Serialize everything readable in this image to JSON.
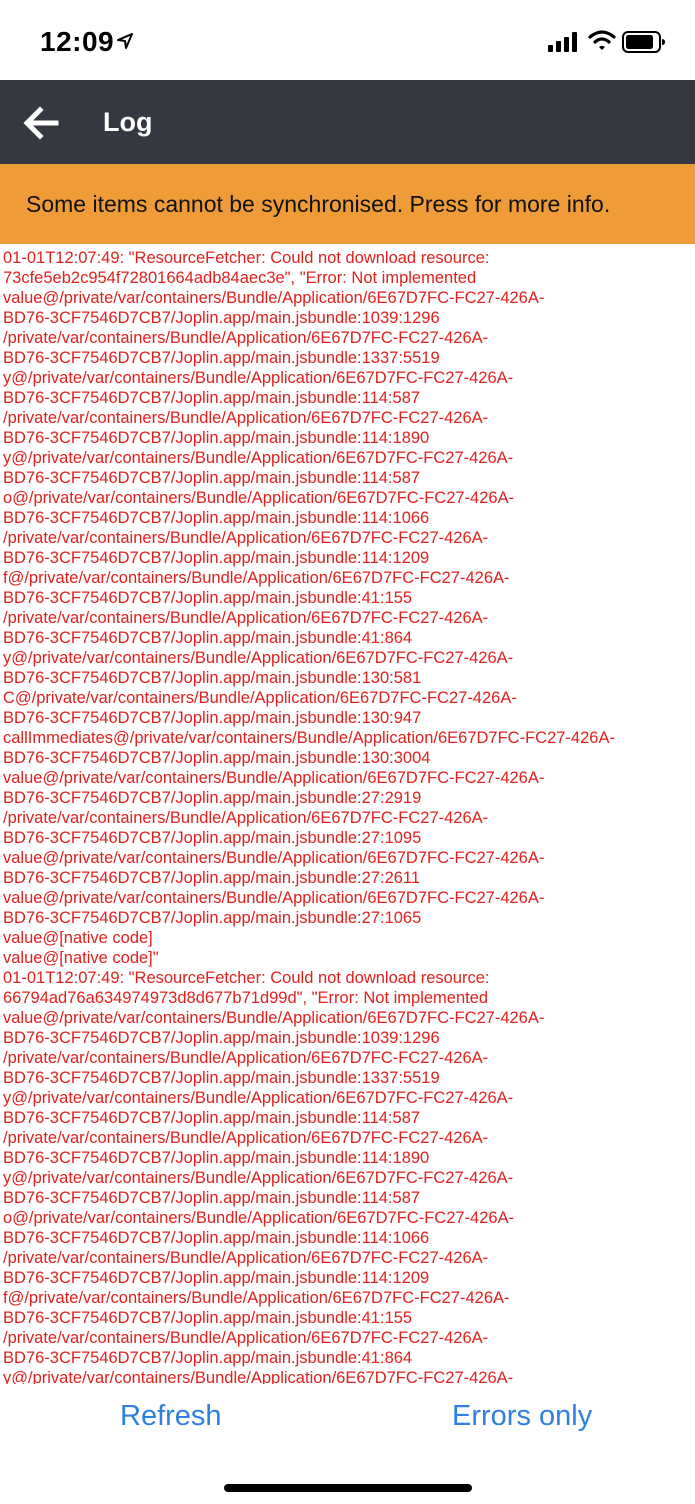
{
  "status_bar": {
    "time": "12:09",
    "icons": [
      "location-arrow-icon",
      "cellular-signal-icon",
      "wifi-icon",
      "battery-icon"
    ]
  },
  "header": {
    "back_icon": "back-arrow-icon",
    "title": "Log"
  },
  "banner": {
    "text": "Some items cannot be synchronised. Press for more info."
  },
  "log": {
    "lines": [
      "01-01T12:07:49: \"ResourceFetcher: Could not download resource:",
      "73cfe5eb2c954f72801664adb84aec3e\", \"Error: Not implemented",
      "value@/private/var/containers/Bundle/Application/6E67D7FC-FC27-426A-",
      "BD76-3CF7546D7CB7/Joplin.app/main.jsbundle:1039:1296",
      "/private/var/containers/Bundle/Application/6E67D7FC-FC27-426A-",
      "BD76-3CF7546D7CB7/Joplin.app/main.jsbundle:1337:5519",
      "y@/private/var/containers/Bundle/Application/6E67D7FC-FC27-426A-",
      "BD76-3CF7546D7CB7/Joplin.app/main.jsbundle:114:587",
      "/private/var/containers/Bundle/Application/6E67D7FC-FC27-426A-",
      "BD76-3CF7546D7CB7/Joplin.app/main.jsbundle:114:1890",
      "y@/private/var/containers/Bundle/Application/6E67D7FC-FC27-426A-",
      "BD76-3CF7546D7CB7/Joplin.app/main.jsbundle:114:587",
      "o@/private/var/containers/Bundle/Application/6E67D7FC-FC27-426A-",
      "BD76-3CF7546D7CB7/Joplin.app/main.jsbundle:114:1066",
      "/private/var/containers/Bundle/Application/6E67D7FC-FC27-426A-",
      "BD76-3CF7546D7CB7/Joplin.app/main.jsbundle:114:1209",
      "f@/private/var/containers/Bundle/Application/6E67D7FC-FC27-426A-",
      "BD76-3CF7546D7CB7/Joplin.app/main.jsbundle:41:155",
      "/private/var/containers/Bundle/Application/6E67D7FC-FC27-426A-",
      "BD76-3CF7546D7CB7/Joplin.app/main.jsbundle:41:864",
      "y@/private/var/containers/Bundle/Application/6E67D7FC-FC27-426A-",
      "BD76-3CF7546D7CB7/Joplin.app/main.jsbundle:130:581",
      "C@/private/var/containers/Bundle/Application/6E67D7FC-FC27-426A-",
      "BD76-3CF7546D7CB7/Joplin.app/main.jsbundle:130:947",
      "callImmediates@/private/var/containers/Bundle/Application/6E67D7FC-FC27-426A-",
      "BD76-3CF7546D7CB7/Joplin.app/main.jsbundle:130:3004",
      "value@/private/var/containers/Bundle/Application/6E67D7FC-FC27-426A-",
      "BD76-3CF7546D7CB7/Joplin.app/main.jsbundle:27:2919",
      "/private/var/containers/Bundle/Application/6E67D7FC-FC27-426A-",
      "BD76-3CF7546D7CB7/Joplin.app/main.jsbundle:27:1095",
      "value@/private/var/containers/Bundle/Application/6E67D7FC-FC27-426A-",
      "BD76-3CF7546D7CB7/Joplin.app/main.jsbundle:27:2611",
      "value@/private/var/containers/Bundle/Application/6E67D7FC-FC27-426A-",
      "BD76-3CF7546D7CB7/Joplin.app/main.jsbundle:27:1065",
      "value@[native code]",
      "value@[native code]\"",
      "01-01T12:07:49: \"ResourceFetcher: Could not download resource:",
      "66794ad76a634974973d8d677b71d99d\", \"Error: Not implemented",
      "value@/private/var/containers/Bundle/Application/6E67D7FC-FC27-426A-",
      "BD76-3CF7546D7CB7/Joplin.app/main.jsbundle:1039:1296",
      "/private/var/containers/Bundle/Application/6E67D7FC-FC27-426A-",
      "BD76-3CF7546D7CB7/Joplin.app/main.jsbundle:1337:5519",
      "y@/private/var/containers/Bundle/Application/6E67D7FC-FC27-426A-",
      "BD76-3CF7546D7CB7/Joplin.app/main.jsbundle:114:587",
      "/private/var/containers/Bundle/Application/6E67D7FC-FC27-426A-",
      "BD76-3CF7546D7CB7/Joplin.app/main.jsbundle:114:1890",
      "y@/private/var/containers/Bundle/Application/6E67D7FC-FC27-426A-",
      "BD76-3CF7546D7CB7/Joplin.app/main.jsbundle:114:587",
      "o@/private/var/containers/Bundle/Application/6E67D7FC-FC27-426A-",
      "BD76-3CF7546D7CB7/Joplin.app/main.jsbundle:114:1066",
      "/private/var/containers/Bundle/Application/6E67D7FC-FC27-426A-",
      "BD76-3CF7546D7CB7/Joplin.app/main.jsbundle:114:1209",
      "f@/private/var/containers/Bundle/Application/6E67D7FC-FC27-426A-",
      "BD76-3CF7546D7CB7/Joplin.app/main.jsbundle:41:155",
      "/private/var/containers/Bundle/Application/6E67D7FC-FC27-426A-",
      "BD76-3CF7546D7CB7/Joplin.app/main.jsbundle:41:864",
      "y@/private/var/containers/Bundle/Application/6E67D7FC-FC27-426A-"
    ]
  },
  "bottom": {
    "refresh_label": "Refresh",
    "errors_only_label": "Errors only"
  },
  "colors": {
    "header_bg": "#353840",
    "banner_bg": "#ef9c38",
    "log_text": "#e0211d",
    "button_text": "#2f7fe6"
  }
}
